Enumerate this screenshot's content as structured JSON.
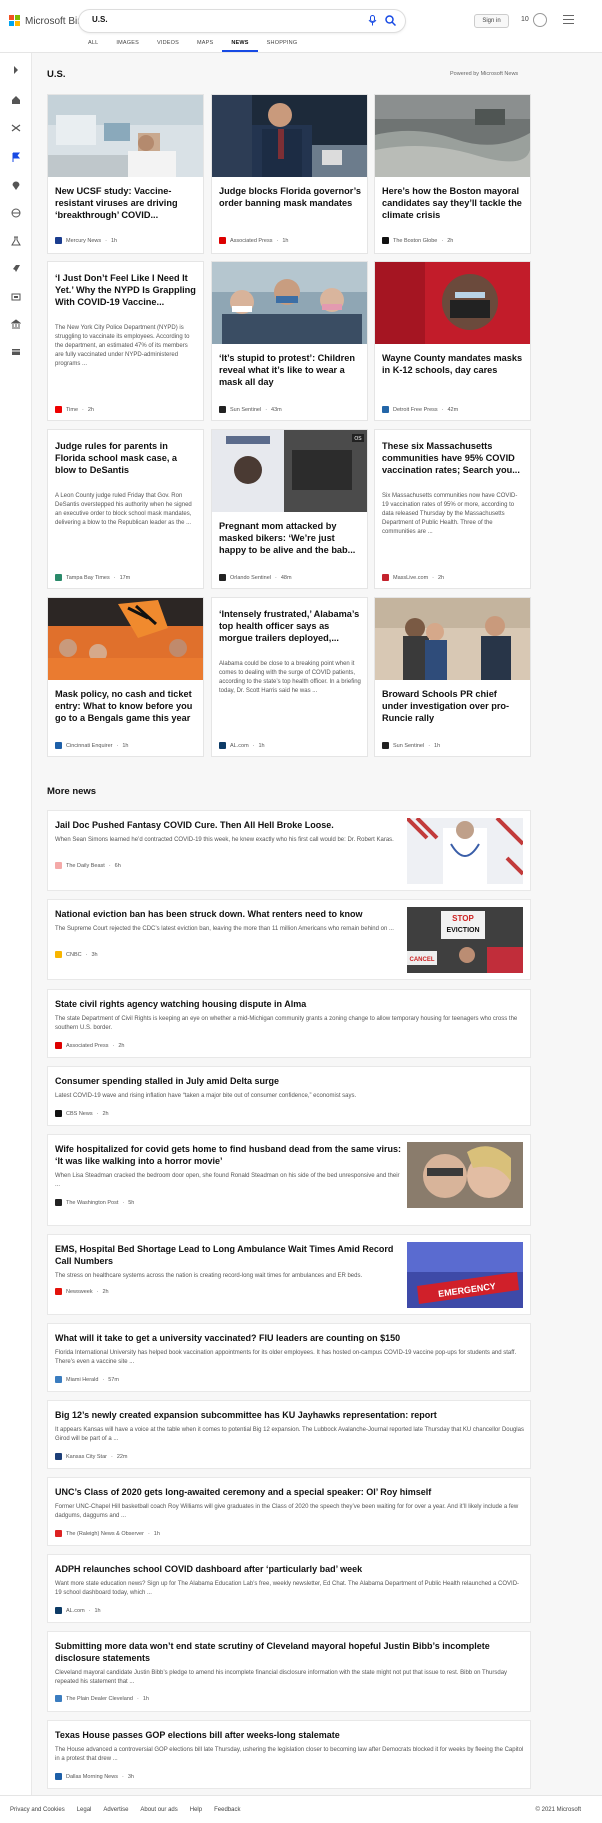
{
  "header": {
    "brand": "Microsoft Bing",
    "search_value": "U.S.",
    "signin_label": "Sign in",
    "rewards_count": "10",
    "tabs": [
      {
        "label": "ALL"
      },
      {
        "label": "IMAGES"
      },
      {
        "label": "VIDEOS"
      },
      {
        "label": "MAPS"
      },
      {
        "label": "NEWS"
      },
      {
        "label": "SHOPPING"
      }
    ],
    "active_tab": "NEWS",
    "colors": {
      "accent": "#174ae4",
      "ms_red": "#f25022",
      "ms_green": "#7fba00",
      "ms_blue": "#00a4ef",
      "ms_yellow": "#ffb900"
    }
  },
  "rail_icons": [
    "chevron-right-icon",
    "home-icon",
    "shuffle-icon",
    "flag-icon",
    "location-icon",
    "globe-icon",
    "science-icon",
    "rocket-icon",
    "film-icon",
    "bank-icon",
    "card-icon"
  ],
  "main": {
    "section_title": "U.S.",
    "powered_by": "Powered by Microsoft News",
    "cards": [
      {
        "title": "New UCSF study: Vaccine-resistant viruses are driving ‘breakthrough’ COVID...",
        "source": "Mercury News",
        "age": "1h",
        "desc": ""
      },
      {
        "title": "Judge blocks Florida governor’s order banning mask mandates",
        "source": "Associated Press",
        "age": "1h",
        "desc": ""
      },
      {
        "title": "Here’s how the Boston mayoral candidates say they’ll tackle the climate crisis",
        "source": "The Boston Globe",
        "age": "2h",
        "desc": ""
      },
      {
        "title": "‘I Just Don’t Feel Like I Need It Yet.’ Why the NYPD Is Grappling With COVID-19 Vaccine...",
        "source": "Time",
        "age": "2h",
        "desc": "The New York City Police Department (NYPD) is struggling to vaccinate its employees. According to the department, an estimated 47% of its members are fully vaccinated under NYPD-administered programs ..."
      },
      {
        "title": "‘It’s stupid to protest’: Children reveal what it’s like to wear a mask all day",
        "source": "Sun Sentinel",
        "age": "43m",
        "desc": ""
      },
      {
        "title": "Wayne County mandates masks in K-12 schools, day cares",
        "source": "Detroit Free Press",
        "age": "42m",
        "desc": ""
      },
      {
        "title": "Judge rules for parents in Florida school mask case, a blow to DeSantis",
        "source": "Tampa Bay Times",
        "age": "17m",
        "desc": "A Leon County judge ruled Friday that Gov. Ron DeSantis overstepped his authority when he signed an executive order to block school mask mandates, delivering a blow to the Republican leader as the ..."
      },
      {
        "title": "Pregnant mom attacked by masked bikers: ‘We’re just happy to be alive and the bab...",
        "source": "Orlando Sentinel",
        "age": "48m",
        "desc": ""
      },
      {
        "title": "These six Massachusetts communities have 95% COVID vaccination rates; Search you...",
        "source": "MassLive.com",
        "age": "2h",
        "desc": "Six Massachusetts communities now have COVID-19 vaccination rates of 95% or more, according to data released Thursday by the Massachusetts Department of Public Health. Three of the communities are ..."
      },
      {
        "title": "Mask policy, no cash and ticket entry: What to know before you go to a Bengals game this year",
        "source": "Cincinnati Enquirer",
        "age": "1h",
        "desc": ""
      },
      {
        "title": "‘Intensely frustrated,’ Alabama’s top health officer says as morgue trailers deployed,...",
        "source": "AL.com",
        "age": "1h",
        "desc": "Alabama could be close to a breaking point when it comes to dealing with the surge of COVID patients, according to the state’s top health officer. In a briefing today, Dr. Scott Harris said he was ..."
      },
      {
        "title": "Broward Schools PR chief under investigation over pro-Runcie rally",
        "source": "Sun Sentinel",
        "age": "1h",
        "desc": ""
      }
    ],
    "card_overlay_tag": "OS",
    "more_title": "More news",
    "more_news": [
      {
        "title": "Jail Doc Pushed Fantasy COVID Cure. Then All Hell Broke Loose.",
        "desc": "When Sean Simons learned he’d contracted COVID-19 this week, he knew exactly who his first call would be: Dr. Robert Karas.",
        "source": "The Daily Beast",
        "age": "6h"
      },
      {
        "title": "National eviction ban has been struck down. What renters need to know",
        "desc": "The Supreme Court rejected the CDC’s latest eviction ban, leaving the more than 11 million Americans who remain behind on ...",
        "source": "CNBC",
        "age": "3h"
      },
      {
        "title": "State civil rights agency watching housing dispute in Alma",
        "desc": "The state Department of Civil Rights is keeping an eye on whether a mid-Michigan community grants a zoning change to allow temporary housing for teenagers who cross the southern U.S. border.",
        "source": "Associated Press",
        "age": "2h"
      },
      {
        "title": "Consumer spending stalled in July amid Delta surge",
        "desc": "Latest COVID-19 wave and rising inflation have “taken a major bite out of consumer confidence,” economist says.",
        "source": "CBS News",
        "age": "2h"
      },
      {
        "title": "Wife hospitalized for covid gets home to find husband dead from the same virus: ‘It was like walking into a horror movie’",
        "desc": "When Lisa Steadman cracked the bedroom door open, she found Ronald Steadman on his side of the bed unresponsive and their ...",
        "source": "The Washington Post",
        "age": "5h"
      },
      {
        "title": "EMS, Hospital Bed Shortage Lead to Long Ambulance Wait Times Amid Record Call Numbers",
        "desc": "The stress on healthcare systems across the nation is creating record-long wait times for ambulances and ER beds.",
        "source": "Newsweek",
        "age": "2h"
      },
      {
        "title": "What will it take to get a university vaccinated? FIU leaders are counting on $150",
        "desc": "Florida International University has helped book vaccination appointments for its older employees. It has hosted on-campus COVID-19 vaccine pop-ups for students and staff. There’s even a vaccine site ...",
        "source": "Miami Herald",
        "age": "57m"
      },
      {
        "title": "Big 12’s newly created expansion subcommittee has KU Jayhawks representation: report",
        "desc": "It appears Kansas will have a voice at the table when it comes to potential Big 12 expansion. The Lubbock Avalanche-Journal reported late Thursday that KU chancellor Douglas Girod will be part of a ...",
        "source": "Kansas City Star",
        "age": "22m"
      },
      {
        "title": "UNC’s Class of 2020 gets long-awaited ceremony and a special speaker: Ol’ Roy himself",
        "desc": "Former UNC-Chapel Hill basketball coach Roy Williams will give graduates in the Class of 2020 the speech they’ve been waiting for for over a year. And it’ll likely include a few dadgums, daggums and ...",
        "source": "The (Raleigh) News & Observer",
        "age": "1h"
      },
      {
        "title": "ADPH relaunches school COVID dashboard after ‘particularly bad’ week",
        "desc": "Want more state education news? Sign up for The Alabama Education Lab’s free, weekly newsletter, Ed Chat. The Alabama Department of Public Health relaunched a COVID-19 school dashboard today, which ...",
        "source": "AL.com",
        "age": "1h"
      },
      {
        "title": "Submitting more data won’t end state scrutiny of Cleveland mayoral hopeful Justin Bibb’s incomplete disclosure statements",
        "desc": "Cleveland mayoral candidate Justin Bibb’s pledge to amend his incomplete financial disclosure information with the state might not put that issue to rest. Bibb on Thursday repeated his statement that ...",
        "source": "The Plain Dealer Cleveland",
        "age": "1h"
      },
      {
        "title": "Texas House passes GOP elections bill after weeks-long stalemate",
        "desc": "The House advanced a controversial GOP elections bill late Thursday, ushering the legislation closer to becoming law after Democrats blocked it for weeks by fleeing the Capitol in a protest that drew ...",
        "source": "Dallas Morning News",
        "age": "3h"
      }
    ],
    "thumb_texts": {
      "stop": "STOP",
      "eviction": "EVICTION",
      "cancel": "CANCEL",
      "emergency": "EMERGENCY"
    }
  },
  "footer": {
    "links": [
      "Privacy and Cookies",
      "Legal",
      "Advertise",
      "About our ads",
      "Help",
      "Feedback"
    ],
    "copyright": "© 2021 Microsoft"
  }
}
